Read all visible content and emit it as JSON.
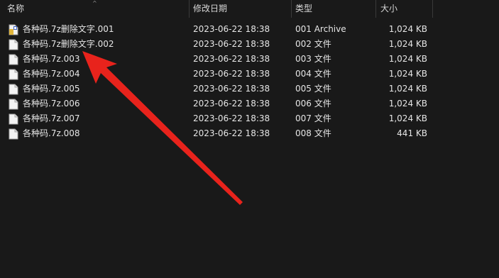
{
  "header": {
    "name": "名称",
    "date": "修改日期",
    "type": "类型",
    "size": "大小",
    "sort_chevron": "^"
  },
  "files": [
    {
      "name": "各种码.7z删除文字.001",
      "date": "2023-06-22 18:38",
      "type": "001 Archive",
      "size": "1,024 KB",
      "icon": "archive-file-icon"
    },
    {
      "name": "各种码.7z删除文字.002",
      "date": "2023-06-22 18:38",
      "type": "002 文件",
      "size": "1,024 KB",
      "icon": "file-icon"
    },
    {
      "name": "各种码.7z.003",
      "date": "2023-06-22 18:38",
      "type": "003 文件",
      "size": "1,024 KB",
      "icon": "file-icon"
    },
    {
      "name": "各种码.7z.004",
      "date": "2023-06-22 18:38",
      "type": "004 文件",
      "size": "1,024 KB",
      "icon": "file-icon"
    },
    {
      "name": "各种码.7z.005",
      "date": "2023-06-22 18:38",
      "type": "005 文件",
      "size": "1,024 KB",
      "icon": "file-icon"
    },
    {
      "name": "各种码.7z.006",
      "date": "2023-06-22 18:38",
      "type": "006 文件",
      "size": "1,024 KB",
      "icon": "file-icon"
    },
    {
      "name": "各种码.7z.007",
      "date": "2023-06-22 18:38",
      "type": "007 文件",
      "size": "1,024 KB",
      "icon": "file-icon"
    },
    {
      "name": "各种码.7z.008",
      "date": "2023-06-22 18:38",
      "type": "008 文件",
      "size": "441 KB",
      "icon": "file-icon"
    }
  ],
  "colors": {
    "background": "#191919",
    "text": "#e6e6e6",
    "annotation_arrow": "#e8231c"
  }
}
